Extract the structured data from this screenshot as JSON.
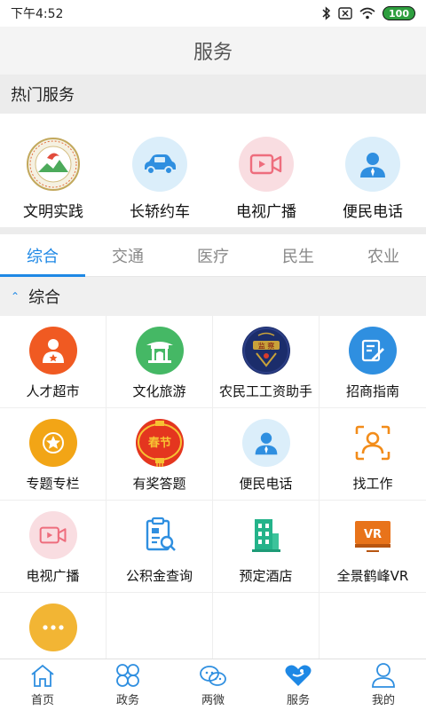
{
  "status_bar": {
    "time": "下午4:52",
    "battery": "100"
  },
  "header": {
    "title": "服务"
  },
  "hot_services": {
    "title": "热门服务",
    "items": [
      {
        "label": "文明实践",
        "icon": "civilization-badge-icon"
      },
      {
        "label": "长轿约车",
        "icon": "car-icon"
      },
      {
        "label": "电视广播",
        "icon": "video-camera-icon"
      },
      {
        "label": "便民电话",
        "icon": "person-icon"
      }
    ]
  },
  "tabs": [
    "综合",
    "交通",
    "医疗",
    "民生",
    "农业"
  ],
  "active_tab": "综合",
  "section": {
    "title": "综合"
  },
  "grid": [
    {
      "label": "人才超市",
      "icon": "talent-icon"
    },
    {
      "label": "文化旅游",
      "icon": "pavilion-icon"
    },
    {
      "label": "农民工工资助手",
      "icon": "supervision-badge-icon"
    },
    {
      "label": "招商指南",
      "icon": "edit-doc-icon"
    },
    {
      "label": "专题专栏",
      "icon": "star-icon"
    },
    {
      "label": "有奖答题",
      "icon": "spring-festival-icon",
      "badge_text": "春节"
    },
    {
      "label": "便民电话",
      "icon": "person-icon"
    },
    {
      "label": "找工作",
      "icon": "job-search-icon"
    },
    {
      "label": "电视广播",
      "icon": "video-camera-icon"
    },
    {
      "label": "公积金查询",
      "icon": "fund-query-icon"
    },
    {
      "label": "预定酒店",
      "icon": "hotel-building-icon"
    },
    {
      "label": "全景鹤峰VR",
      "icon": "vr-icon",
      "badge_text": "VR"
    },
    {
      "label": "更多",
      "icon": "more-icon"
    }
  ],
  "bottom_nav": [
    {
      "label": "首页",
      "icon": "home-icon"
    },
    {
      "label": "政务",
      "icon": "grid-flower-icon"
    },
    {
      "label": "两微",
      "icon": "weibo-wechat-icon"
    },
    {
      "label": "服务",
      "icon": "heart-service-icon",
      "active": true
    },
    {
      "label": "我的",
      "icon": "user-icon"
    }
  ],
  "colors": {
    "accent": "#1e88e5",
    "orange": "#f28c1a",
    "green": "#43b35a",
    "red_light": "#f6d8dd",
    "blue_light": "#dbeefa"
  }
}
